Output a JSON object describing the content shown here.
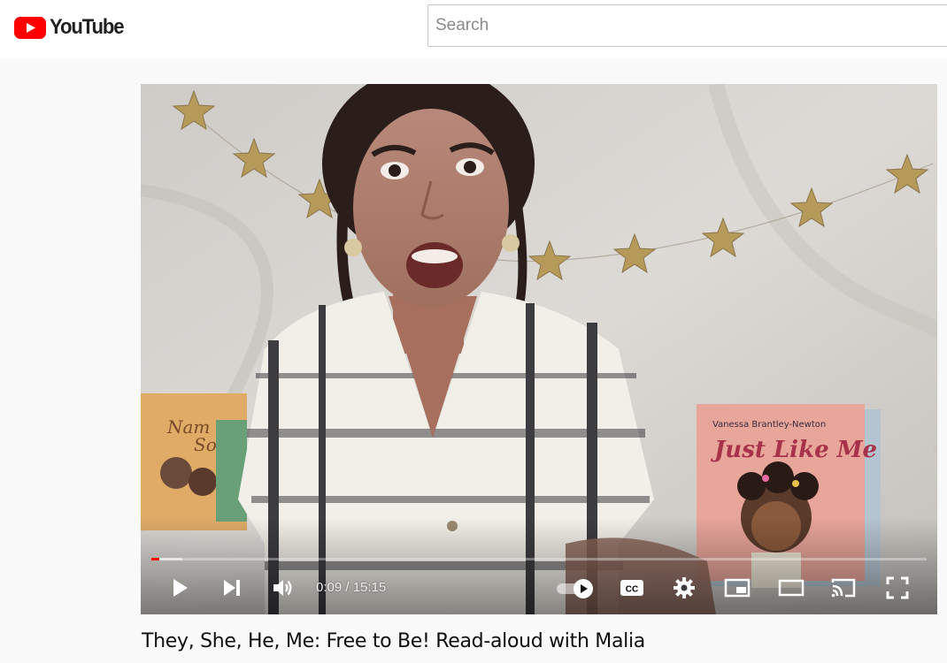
{
  "app": {
    "logo_text": "YouTube"
  },
  "search": {
    "placeholder": "Search"
  },
  "player": {
    "time_current": "0:09",
    "time_separator": " / ",
    "time_total": "15:15",
    "progress_played": 0.0098,
    "progress_loaded": 0.04,
    "scene": {
      "book_right_title": "Just Like Me",
      "book_right_author": "Vanessa Brantley-Newton",
      "book_left_title_fragment": "Nam So"
    },
    "colors": {
      "played": "#ff0000",
      "brand": "#ff0000"
    }
  },
  "video": {
    "title": "They, She, He, Me: Free to Be! Read-aloud with Malia"
  },
  "icons": [
    "youtube-logo-icon",
    "play-icon",
    "next-icon",
    "volume-icon",
    "autoplay-toggle-icon",
    "captions-icon",
    "settings-gear-icon",
    "miniplayer-icon",
    "theater-mode-icon",
    "cast-icon",
    "fullscreen-icon"
  ]
}
